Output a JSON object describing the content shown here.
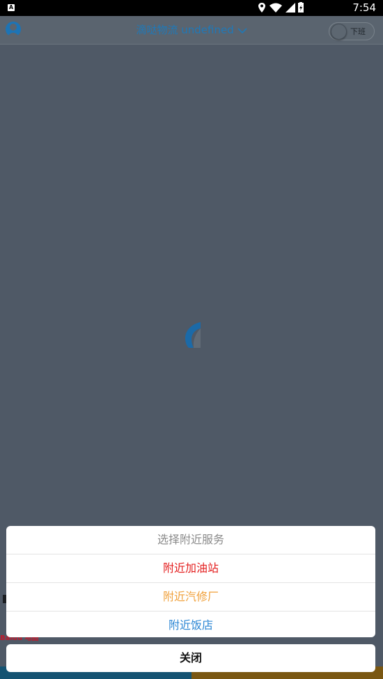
{
  "status_bar": {
    "notification_icon": "A",
    "time": "7:54"
  },
  "app_bar": {
    "title": "滴哒物流 undefined",
    "duty_toggle_label": "下班"
  },
  "background_peek": {
    "brand_text": "Baidu 地图"
  },
  "action_sheet": {
    "title": "选择附近服务",
    "options": [
      {
        "label": "附近加油站",
        "color": "#e31c1c"
      },
      {
        "label": "附近汽修厂",
        "color": "#f0a03a"
      },
      {
        "label": "附近饭店",
        "color": "#2b86d4"
      }
    ],
    "close_label": "关闭"
  },
  "colors": {
    "overlay": "#4f5966",
    "brand_blue": "#1f79b8"
  }
}
